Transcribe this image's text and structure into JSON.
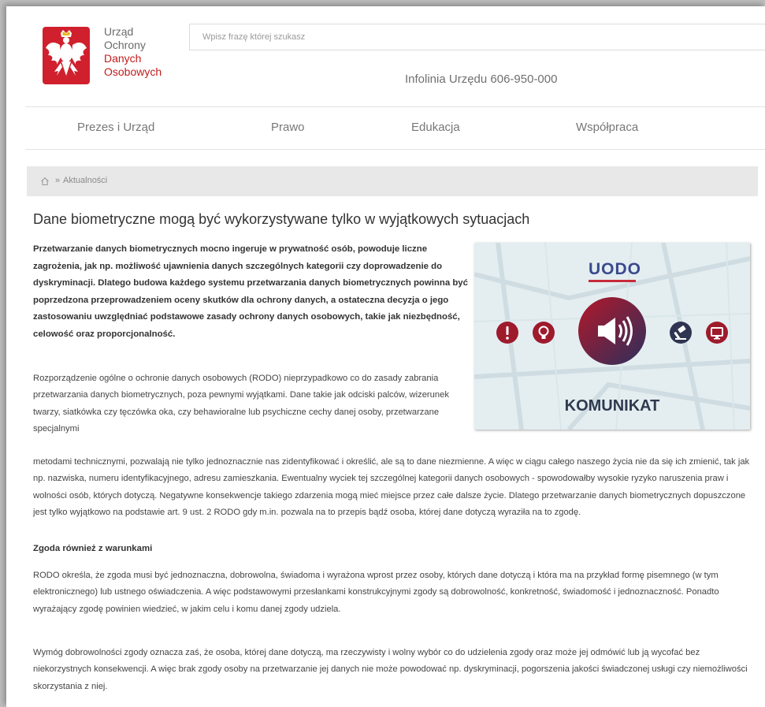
{
  "header": {
    "org_name": {
      "line1": "Urząd",
      "line2": "Ochrony",
      "line3": "Danych",
      "line4": "Osobowych"
    },
    "search_placeholder": "Wpisz frazę której szukasz",
    "infoline": "Infolinia Urzędu 606-950-000"
  },
  "nav": {
    "items": [
      {
        "label": "Prezes i Urząd"
      },
      {
        "label": "Prawo"
      },
      {
        "label": "Edukacja"
      },
      {
        "label": "Współpraca"
      }
    ]
  },
  "breadcrumb": {
    "separator": "»",
    "current": "Aktualności",
    "home_icon": "home-icon"
  },
  "article": {
    "title": "Dane biometryczne mogą być wykorzystywane tylko w wyjątkowych sytuacjach",
    "lead": "Przetwarzanie danych biometrycznych mocno ingeruje w prywatność osób, powoduje liczne zagrożenia, jak np. możliwość ujawnienia danych szczególnych kategorii czy doprowadzenie do dyskryminacji. Dlatego budowa każdego systemu przetwarzania danych biometrycznych powinna być poprzedzona przeprowadzeniem oceny skutków dla ochrony danych, a ostateczna decyzja o jego zastosowaniu uwzględniać podstawowe zasady ochrony danych osobowych, takie jak niezbędność, celowość oraz proporcjonalność.",
    "p1a": "Rozporządzenie ogólne o ochronie danych osobowych (RODO) nieprzypadkowo co do zasady zabrania przetwarzania danych biometrycznych, poza pewnymi wyjątkami. Dane takie jak odciski palców, wizerunek twarzy, siatkówka czy tęczówka oka, czy behawioralne lub psychiczne cechy danej osoby, przetwarzane specjalnymi",
    "p1b": "metodami technicznymi, pozwalają nie tylko jednoznacznie nas zidentyfikować i określić, ale są to dane niezmienne. A więc w ciągu całego naszego życia nie da się ich zmienić, tak jak np. nazwiska, numeru identyfikacyjnego, adresu zamieszkania. Ewentualny wyciek tej szczególnej kategorii danych osobowych - spowodowałby wysokie ryzyko naruszenia praw i wolności osób, których dotyczą. Negatywne konsekwencje takiego zdarzenia mogą mieć miejsce przez całe dalsze życie. Dlatego przetwarzanie danych biometrycznych dopuszczone jest tylko wyjątkowo na podstawie art. 9 ust. 2 RODO gdy m.in.  pozwala na to przepis bądź osoba, której dane dotyczą wyraziła na to zgodę.",
    "subheading": "Zgoda również z warunkami",
    "p2": "RODO określa, że zgoda musi być jednoznaczna, dobrowolna, świadoma i wyrażona wprost przez osoby, których dane dotyczą i która ma na przykład formę pisemnego (w tym elektronicznego) lub ustnego oświadczenia. A więc podstawowymi przesłankami konstrukcyjnymi zgody są dobrowolność, konkretność, świadomość i jednoznaczność. Ponadto wyrażający zgodę powinien wiedzieć, w jakim celu i komu danej zgody udziela.",
    "p3": "Wymóg dobrowolności zgody oznacza zaś, że osoba, której dane dotyczą, ma rzeczywisty i wolny wybór co do udzielenia zgody oraz może jej odmówić lub ją wycofać bez niekorzystnych konsekwencji. A więc brak zgody osoby na przetwarzanie jej danych nie może powodować np. dyskryminacji, pogorszenia jakości świadczonej usługi czy niemożliwości skorzystania z niej."
  },
  "image": {
    "logo_text": "UODO",
    "label": "KOMUNIKAT",
    "icons": [
      "exclamation-icon",
      "lightbulb-icon",
      "megaphone-icon",
      "gavel-icon",
      "monitor-icon"
    ]
  },
  "colors": {
    "brand_red": "#c01c1c",
    "dark_red": "#9e1b2c",
    "navy": "#3a4a8c"
  }
}
